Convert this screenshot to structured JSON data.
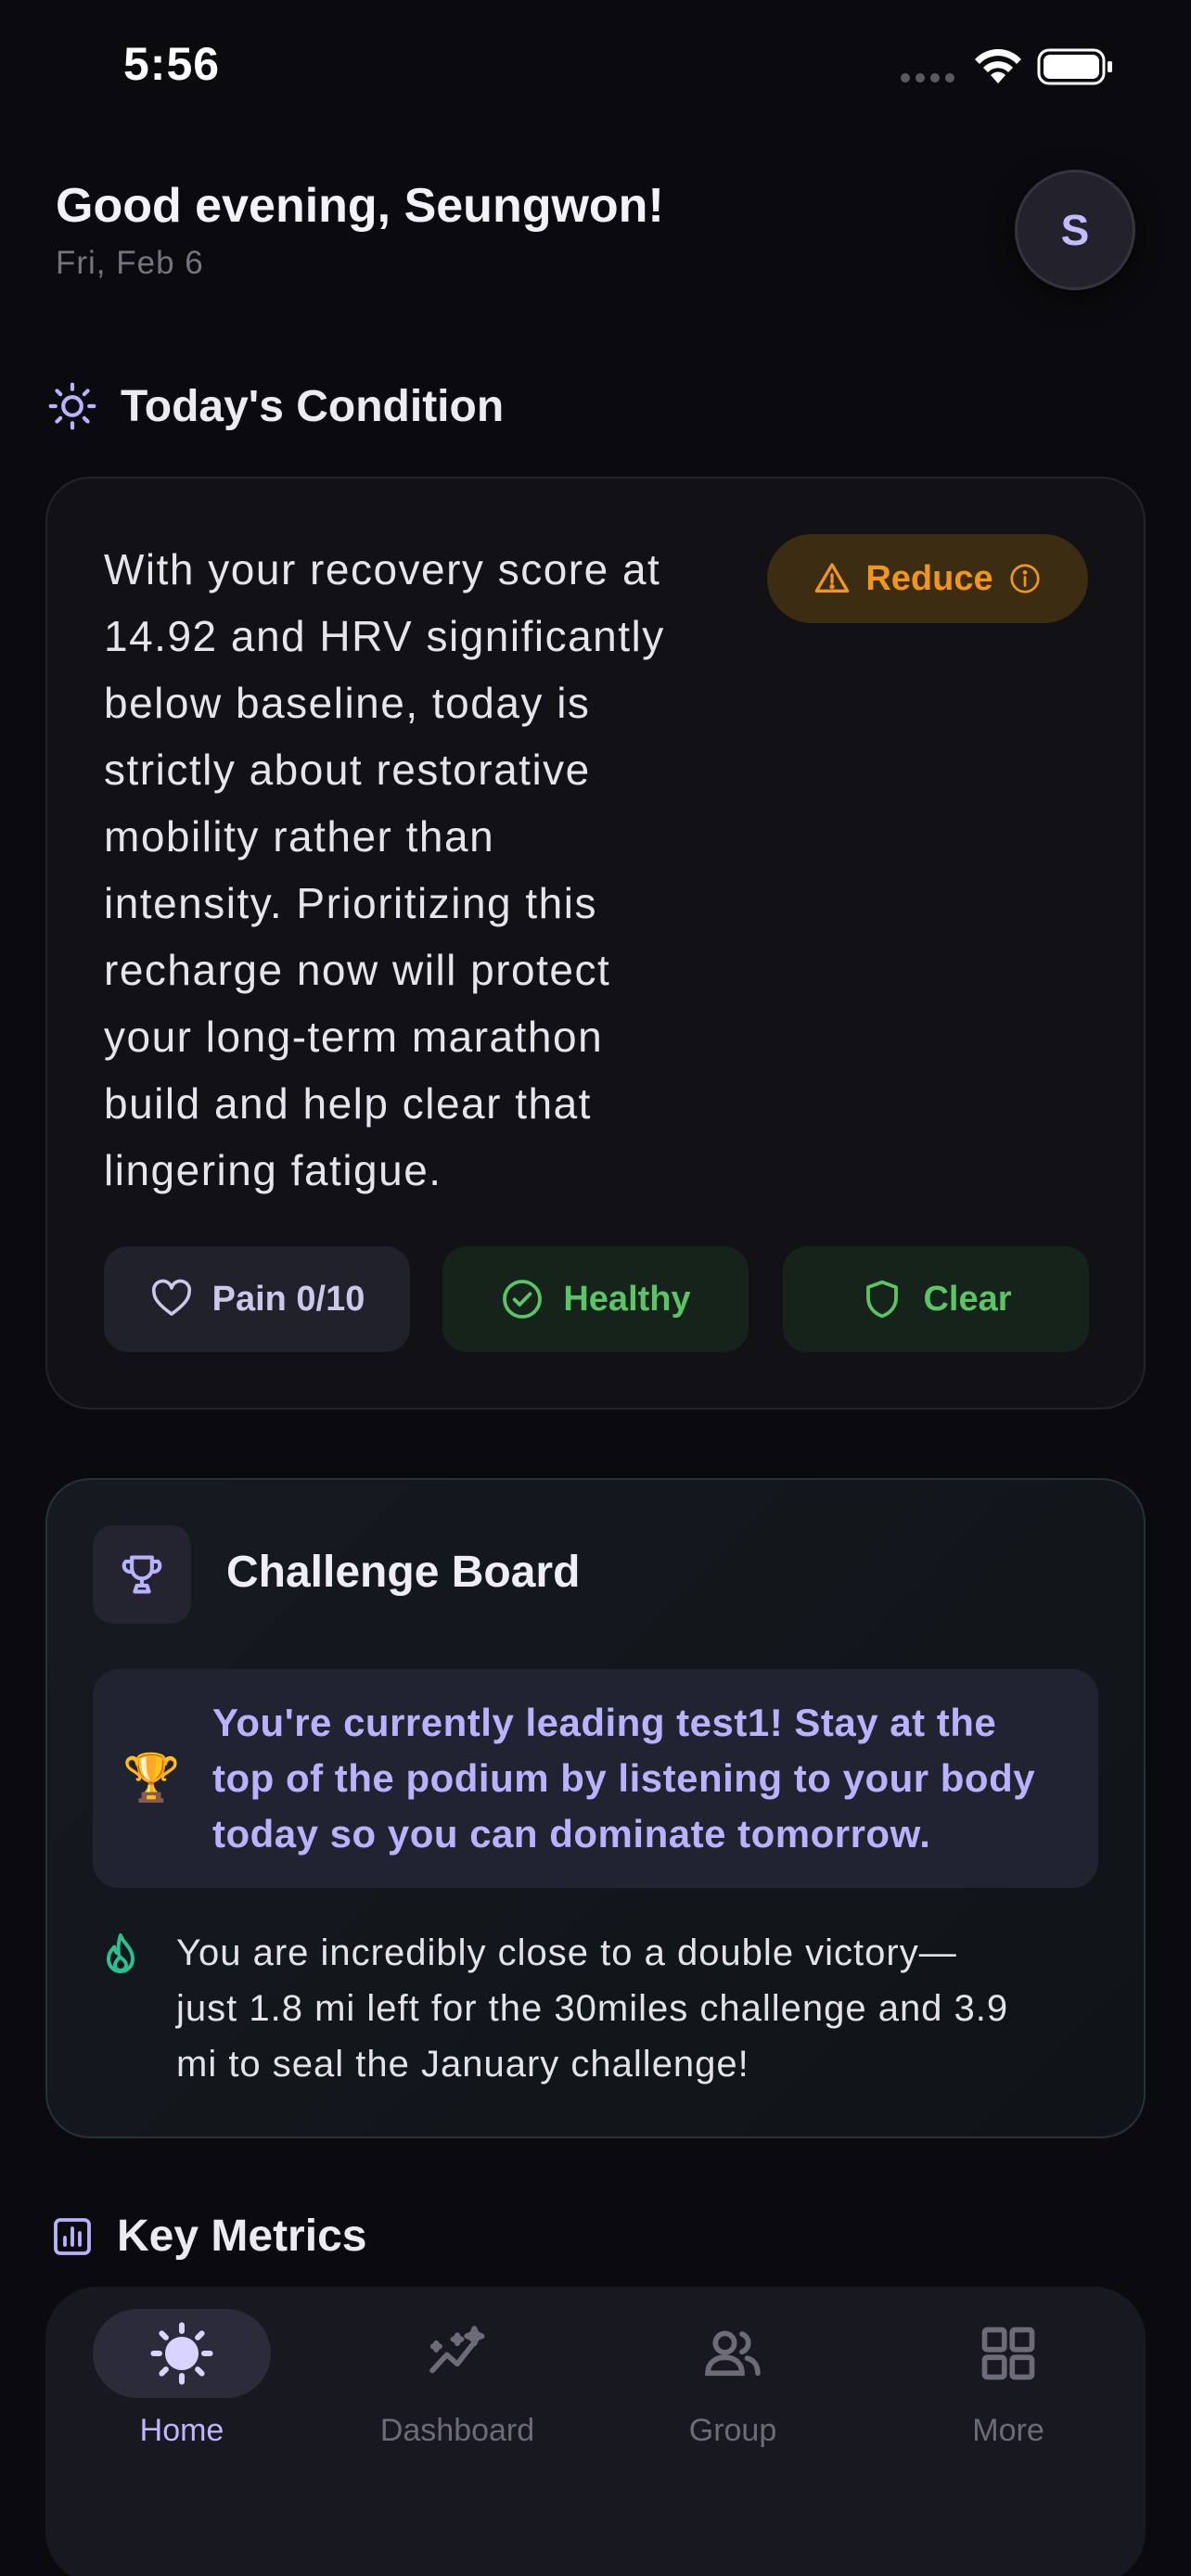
{
  "status_bar": {
    "time": "5:56"
  },
  "header": {
    "greeting": "Good evening, Seungwon!",
    "date": "Fri, Feb 6",
    "avatar_initial": "S"
  },
  "condition": {
    "section_title": "Today's Condition",
    "lines": [
      "With your recovery score at",
      "14.92 and HRV significantly",
      "below baseline, today is",
      "strictly about restorative",
      "mobility rather than",
      "intensity. Prioritizing this",
      "recharge now will protect",
      "your long-term marathon",
      "build and help clear that",
      "lingering fatigue."
    ],
    "badge": "Reduce",
    "chips": {
      "pain": "Pain 0/10",
      "healthy": "Healthy",
      "clear": "Clear"
    }
  },
  "challenge": {
    "title": "Challenge Board",
    "leader_emoji": "🏆",
    "leader_lines": [
      "You're currently leading test1! Stay at the",
      "top of the podium by listening to your body",
      "today so you can dominate tomorrow."
    ],
    "progress_lines": [
      "You are incredibly close to a double victory—",
      "just 1.8 mi left for the 30miles challenge and 3.9",
      "mi to seal the January challenge!"
    ]
  },
  "metrics": {
    "section_title": "Key Metrics"
  },
  "nav": {
    "home": "Home",
    "dashboard": "Dashboard",
    "group": "Group",
    "more": "More"
  },
  "colors": {
    "accent": "#b9b3ff",
    "warning": "#f0961d",
    "success": "#5cc466",
    "flame": "#2fbf8f"
  }
}
